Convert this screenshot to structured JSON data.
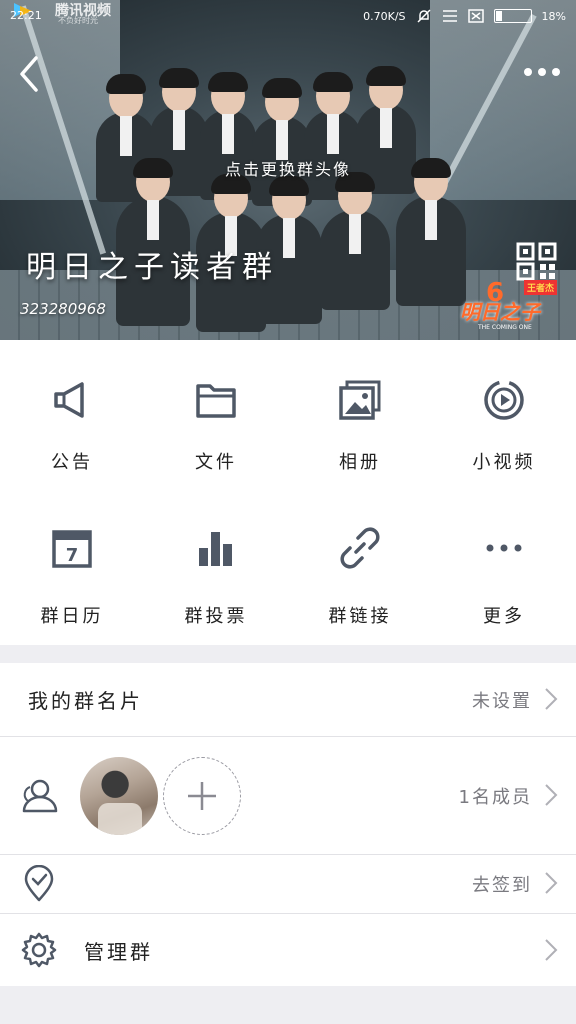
{
  "status_bar": {
    "time": "22:21",
    "brand": "腾讯视频",
    "brand_sub": "不负好时光",
    "network_speed": "0.70K/S",
    "battery_percent": "18%"
  },
  "header": {
    "tap_hint": "点击更换群头像",
    "group_name": "明日之子读者群",
    "group_id": "323280968",
    "show_logo_big": "明日之子",
    "show_logo_tag": "王者杰",
    "show_logo_sub": "THE COMING ONE"
  },
  "features": [
    {
      "label": "公告",
      "icon": "megaphone-icon"
    },
    {
      "label": "文件",
      "icon": "folder-icon"
    },
    {
      "label": "相册",
      "icon": "album-icon"
    },
    {
      "label": "小视频",
      "icon": "video-icon"
    },
    {
      "label": "群日历",
      "icon": "calendar-icon",
      "calendar_day": "7"
    },
    {
      "label": "群投票",
      "icon": "vote-icon"
    },
    {
      "label": "群链接",
      "icon": "link-icon"
    },
    {
      "label": "更多",
      "icon": "more-dots-icon"
    }
  ],
  "card_row": {
    "label": "我的群名片",
    "value": "未设置"
  },
  "members_row": {
    "value": "1名成员"
  },
  "checkin_row": {
    "value": "去签到"
  },
  "manage_row": {
    "label": "管理群"
  },
  "colors": {
    "icon_gray": "#4f5866",
    "accent_text": "#7a7a80",
    "background": "#eeeef2"
  }
}
